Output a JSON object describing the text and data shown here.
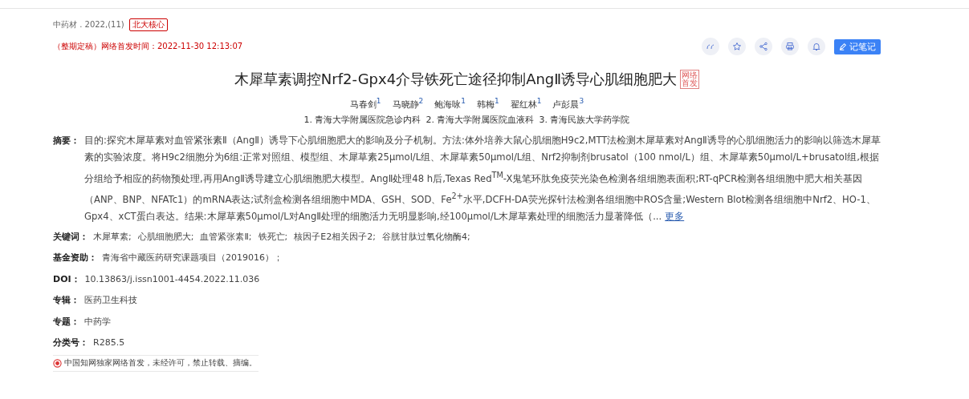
{
  "source": {
    "journal": "中药材 . 2022,(11)",
    "badge": "北大核心"
  },
  "publish": {
    "status": "（整期定稿）",
    "label": "网络首发时间：",
    "time": "2022-11-30 12:13:07"
  },
  "toolbar": [
    {
      "kind": "quote"
    },
    {
      "kind": "star"
    },
    {
      "kind": "share"
    },
    {
      "kind": "print"
    },
    {
      "kind": "bell"
    }
  ],
  "note_button": "记笔记",
  "title": "木犀草素调控Nrf2-Gpx4介导铁死亡途径抑制AngⅡ诱导心肌细胞肥大",
  "title_badge": "网络首发",
  "authors": [
    {
      "name": "马春剑",
      "sup": "1"
    },
    {
      "name": "马晓静",
      "sup": "2"
    },
    {
      "name": "鲍海咏",
      "sup": "1"
    },
    {
      "name": "韩梅",
      "sup": "1"
    },
    {
      "name": "翟红林",
      "sup": "1"
    },
    {
      "name": "卢彭晨",
      "sup": "3"
    }
  ],
  "affiliations": [
    "1. 青海大学附属医院急诊内科",
    "2. 青海大学附属医院血液科",
    "3. 青海民族大学药学院"
  ],
  "abstract": {
    "label": "摘要：",
    "text": "目的:探究木犀草素对血管紧张素Ⅱ（AngⅡ）诱导下心肌细胞肥大的影响及分子机制。方法:体外培养大鼠心肌细胞H9c2,MTT法检测木犀草素对AngⅡ诱导的心肌细胞活力的影响以筛选木犀草素的实验浓度。将H9c2细胞分为6组:正常对照组、模型组、木犀草素25μmol/L组、木犀草素50μmol/L组、Nrf2抑制剂brusatol（100 nmol/L）组、木犀草素50μmol/L+brusatol组,根据分组给予相应的药物预处理,再用AngⅡ诱导建立心肌细胞肥大模型。AngⅡ处理48 h后,Texas Red$^{TM}$-X鬼笔环肽免疫荧光染色检测各组细胞表面积;RT-qPCR检测各组细胞中肥大相关基因（ANP、BNP、NFATc1）的mRNA表达;试剂盒检测各组细胞中MDA、GSH、SOD、Fe$^{2+}$水平,DCFH-DA荧光探针法检测各组细胞中ROS含量;Western Blot检测各组细胞中Nrf2、HO-1、Gpx4、xCT蛋白表达。结果:木犀草素50μmol/L对AngⅡ处理的细胞活力无明显影响,经100μmol/L木犀草素处理的细胞活力显著降低（...",
    "more": "更多"
  },
  "keywords": {
    "label": "关键词：",
    "items": [
      "木犀草素;",
      "心肌细胞肥大;",
      "血管紧张素Ⅱ;",
      "铁死亡;",
      "核因子E2相关因子2;",
      "谷胱甘肽过氧化物酶4;"
    ]
  },
  "fields": [
    {
      "label": "基金资助：",
      "value": "青海省中藏医药研究课题项目（2019016）；"
    },
    {
      "label": "DOI：",
      "value": "10.13863/j.issn1001-4454.2022.11.036"
    },
    {
      "label": "专辑：",
      "value": "医药卫生科技"
    },
    {
      "label": "专题：",
      "value": "中药学"
    },
    {
      "label": "分类号：",
      "value": "R285.5"
    }
  ],
  "notice": "中国知网独家网络首发，未经许可，禁止转载、摘编。"
}
